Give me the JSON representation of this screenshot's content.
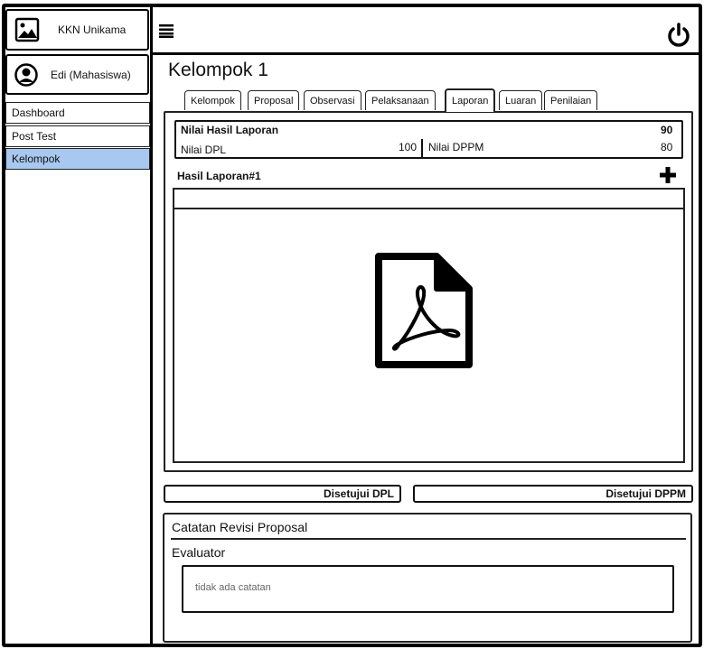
{
  "app": {
    "title": "KKN Unikama",
    "logo_icon": "image-icon"
  },
  "user": {
    "name": "Edi (Mahasiswa)",
    "avatar_icon": "user-avatar-icon"
  },
  "sidebar": {
    "items": [
      {
        "label": "Dashboard",
        "active": false
      },
      {
        "label": "Post Test",
        "active": false
      },
      {
        "label": "Kelompok",
        "active": true
      }
    ],
    "active_color": "#a8c8f0"
  },
  "header": {
    "menu_icon": "hamburger-icon",
    "power_icon": "power-icon"
  },
  "page": {
    "title": "Kelompok 1"
  },
  "tabs": [
    {
      "label": "Kelompok",
      "active": false
    },
    {
      "label": "Proposal",
      "active": false
    },
    {
      "label": "Observasi",
      "active": false
    },
    {
      "label": "Pelaksanaan",
      "active": false
    },
    {
      "label": "Laporan",
      "active": true
    },
    {
      "label": "Luaran",
      "active": false
    },
    {
      "label": "Penilaian",
      "active": false
    }
  ],
  "score": {
    "title": "Nilai Hasil Laporan",
    "total": "90",
    "dpl_label": "Nilai DPL",
    "dpl_value": "100",
    "dppm_label": "Nilai DPPM",
    "dppm_value": "80"
  },
  "report": {
    "title": "Hasil Laporan#1",
    "add_icon": "plus-icon",
    "file_icon": "pdf-file-icon"
  },
  "approvals": {
    "dpl": "Disetujui DPL",
    "dppm": "Disetujui DPPM"
  },
  "notes": {
    "title": "Catatan Revisi Proposal",
    "evaluator_label": "Evaluator",
    "text": "tidak ada catatan"
  }
}
